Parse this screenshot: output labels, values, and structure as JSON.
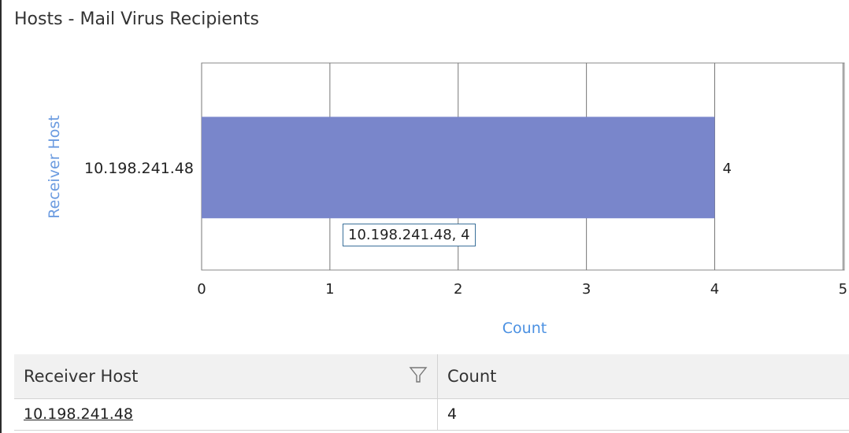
{
  "window": {
    "title": "Hosts - Mail Virus Recipients"
  },
  "chart_data": {
    "type": "bar",
    "orientation": "horizontal",
    "categories": [
      "10.198.241.48"
    ],
    "values": [
      4
    ],
    "xlabel": "Count",
    "ylabel": "Receiver Host",
    "xlim": [
      0,
      5
    ],
    "xticks": [
      0,
      1,
      2,
      3,
      4,
      5
    ],
    "grid": true,
    "bar_color": "#7986cb",
    "data_labels": [
      "4"
    ]
  },
  "tooltip": {
    "text": "10.198.241.48, 4"
  },
  "table": {
    "headers": [
      "Receiver Host",
      "Count"
    ],
    "rows": [
      {
        "host": "10.198.241.48",
        "count": "4"
      }
    ]
  },
  "icons": {
    "filter": "filter-funnel-icon"
  },
  "colors": {
    "axis_title": "#4a90e2",
    "bar": "#7986cb",
    "tooltip_border": "#3a6f99"
  }
}
